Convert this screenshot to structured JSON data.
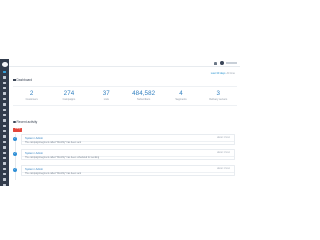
{
  "header": {
    "bell_icon": "bell-icon",
    "avatar_icon": "user-avatar-icon"
  },
  "dashboard": {
    "title": "Dashboard",
    "filters": [
      "Last 30 days",
      "All time"
    ]
  },
  "stats": [
    {
      "value": "2",
      "label": "Customers"
    },
    {
      "value": "274",
      "label": "Campaigns"
    },
    {
      "value": "37",
      "label": "Lists"
    },
    {
      "value": "484,582",
      "label": "Subscribers"
    },
    {
      "value": "4",
      "label": "Segments"
    },
    {
      "value": "3",
      "label": "Delivery servers"
    }
  ],
  "activity": {
    "title": "Recent activity",
    "badge": "Today",
    "items": [
      {
        "title": "System / Admin",
        "time": "about 1 hour",
        "desc": "The campaign/segment called \"Monthly\" has been sent"
      },
      {
        "title": "System / Admin",
        "time": "about 1 hour",
        "desc": "The campaign/segment called \"Monthly\" has been scheduled for sending"
      },
      {
        "title": "System / Admin",
        "time": "about 1 hour",
        "desc": "The campaign/segment called \"Monthly\" has been sent"
      }
    ]
  },
  "colors": {
    "sidebar": "#323c4c",
    "accent": "#2f7fc0",
    "badge": "#e4463b"
  }
}
